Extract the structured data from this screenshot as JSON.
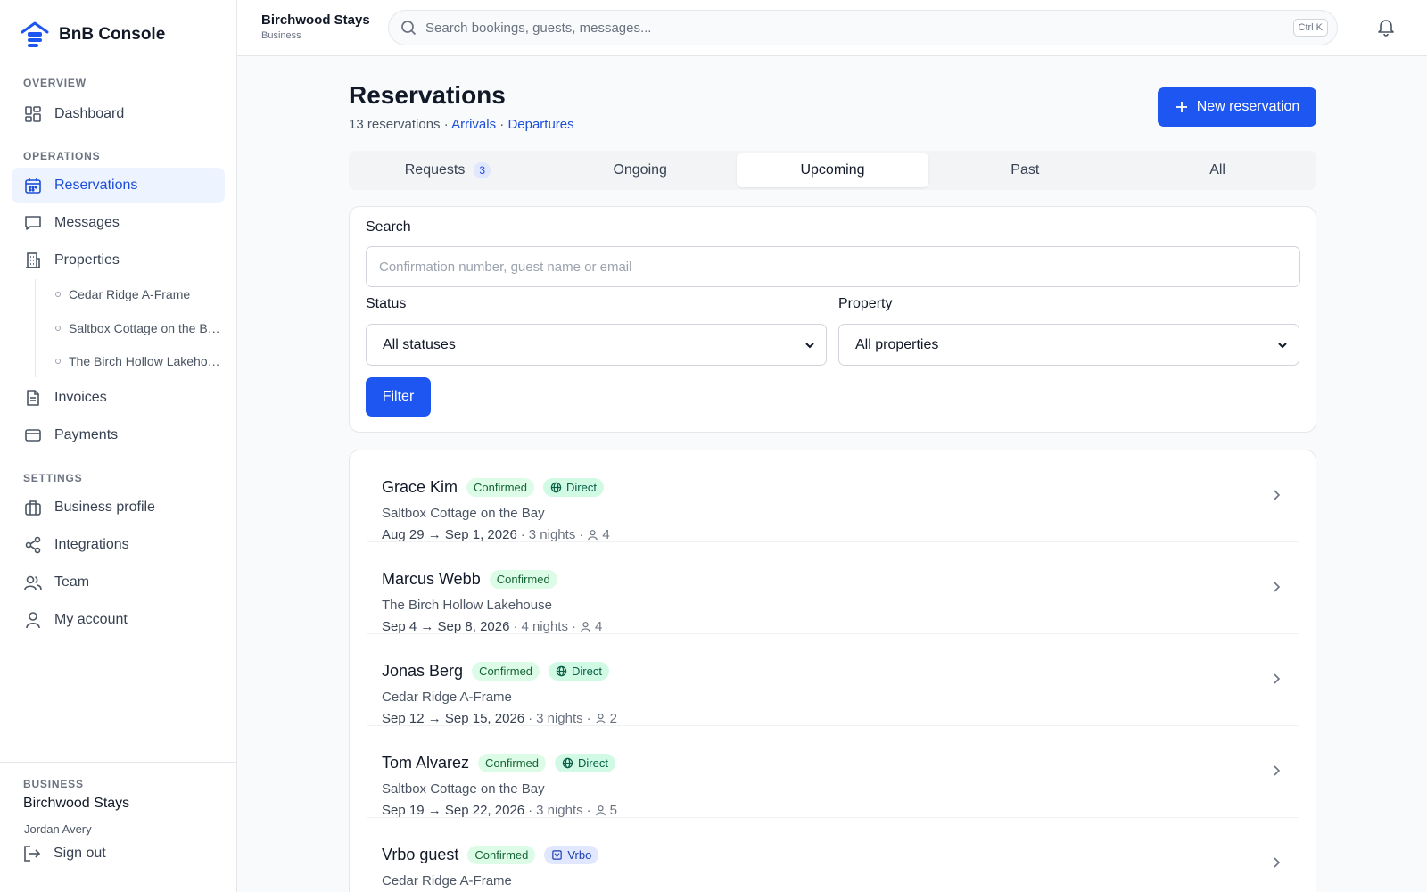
{
  "brand": {
    "name": "BnB Console"
  },
  "sidebar": {
    "sections": {
      "overview": "OVERVIEW",
      "operations": "OPERATIONS",
      "settings": "SETTINGS"
    },
    "items": {
      "dashboard": "Dashboard",
      "reservations": "Reservations",
      "messages": "Messages",
      "properties": "Properties",
      "invoices": "Invoices",
      "payments": "Payments",
      "business_profile": "Business profile",
      "integrations": "Integrations",
      "team": "Team",
      "my_account": "My account"
    },
    "properties_sub": [
      "Cedar Ridge A-Frame",
      "Saltbox Cottage on the Bay",
      "The Birch Hollow Lakehouse"
    ],
    "footer": {
      "label": "BUSINESS",
      "business": "Birchwood Stays",
      "user": "Jordan Avery",
      "sign_out": "Sign out"
    }
  },
  "topbar": {
    "workspace": "Birchwood Stays",
    "workspace_type": "Business",
    "search_placeholder": "Search bookings, guests, messages...",
    "shortcut": "Ctrl K"
  },
  "page": {
    "title": "Reservations",
    "count": "13 reservations",
    "sep": "·",
    "arrivals": "Arrivals",
    "departures": "Departures",
    "new_button": "New reservation"
  },
  "tabs": [
    {
      "label": "Requests",
      "badge": "3"
    },
    {
      "label": "Ongoing"
    },
    {
      "label": "Upcoming",
      "active": true
    },
    {
      "label": "Past"
    },
    {
      "label": "All"
    }
  ],
  "filters": {
    "search_label": "Search",
    "search_placeholder": "Confirmation number, guest name or email",
    "status_label": "Status",
    "status_value": "All statuses",
    "property_label": "Property",
    "property_value": "All properties",
    "filter_button": "Filter"
  },
  "reservations": [
    {
      "guest": "Grace Kim",
      "status": "Confirmed",
      "channel": "Direct",
      "property": "Saltbox Cottage on the Bay",
      "dates": "Aug 29 → Sep 1, 2026",
      "nights": "3 nights",
      "guests": "4"
    },
    {
      "guest": "Marcus Webb",
      "status": "Confirmed",
      "channel": "",
      "property": "The Birch Hollow Lakehouse",
      "dates": "Sep 4 → Sep 8, 2026",
      "nights": "4 nights",
      "guests": "4"
    },
    {
      "guest": "Jonas Berg",
      "status": "Confirmed",
      "channel": "Direct",
      "property": "Cedar Ridge A-Frame",
      "dates": "Sep 12 → Sep 15, 2026",
      "nights": "3 nights",
      "guests": "2"
    },
    {
      "guest": "Tom Alvarez",
      "status": "Confirmed",
      "channel": "Direct",
      "property": "Saltbox Cottage on the Bay",
      "dates": "Sep 19 → Sep 22, 2026",
      "nights": "3 nights",
      "guests": "5"
    },
    {
      "guest": "Vrbo guest",
      "status": "Confirmed",
      "channel": "Vrbo",
      "property": "Cedar Ridge A-Frame",
      "dates": "",
      "nights": "",
      "guests": ""
    }
  ],
  "colors": {
    "accent": "#1d56f0",
    "active_bg": "#eef4ff",
    "confirmed_bg": "#dcfce7",
    "vrbo_bg": "#e0e7ff"
  }
}
